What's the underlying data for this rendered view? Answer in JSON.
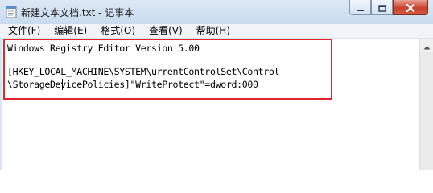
{
  "window": {
    "title": "新建文本文档.txt - 记事本"
  },
  "menu": {
    "items": [
      {
        "label": "文件(F)"
      },
      {
        "label": "编辑(E)"
      },
      {
        "label": "格式(O)"
      },
      {
        "label": "查看(V)"
      },
      {
        "label": "帮助(H)"
      }
    ]
  },
  "editor": {
    "lines": [
      "Windows Registry Editor Version 5.00",
      "",
      "[HKEY_LOCAL_MACHINE\\SYSTEM\\urrentControlSet\\Control",
      "\\StorageDevicePolicies]\"WriteProtect\"=dword:000"
    ]
  },
  "icons": {
    "app": "notepad-icon",
    "minimize": "minimize-icon",
    "maximize": "maximize-icon",
    "close": "close-icon",
    "scroll_up": "chevron-up-icon"
  },
  "colors": {
    "highlight_border": "#e0262a",
    "close_button": "#c8412c"
  }
}
